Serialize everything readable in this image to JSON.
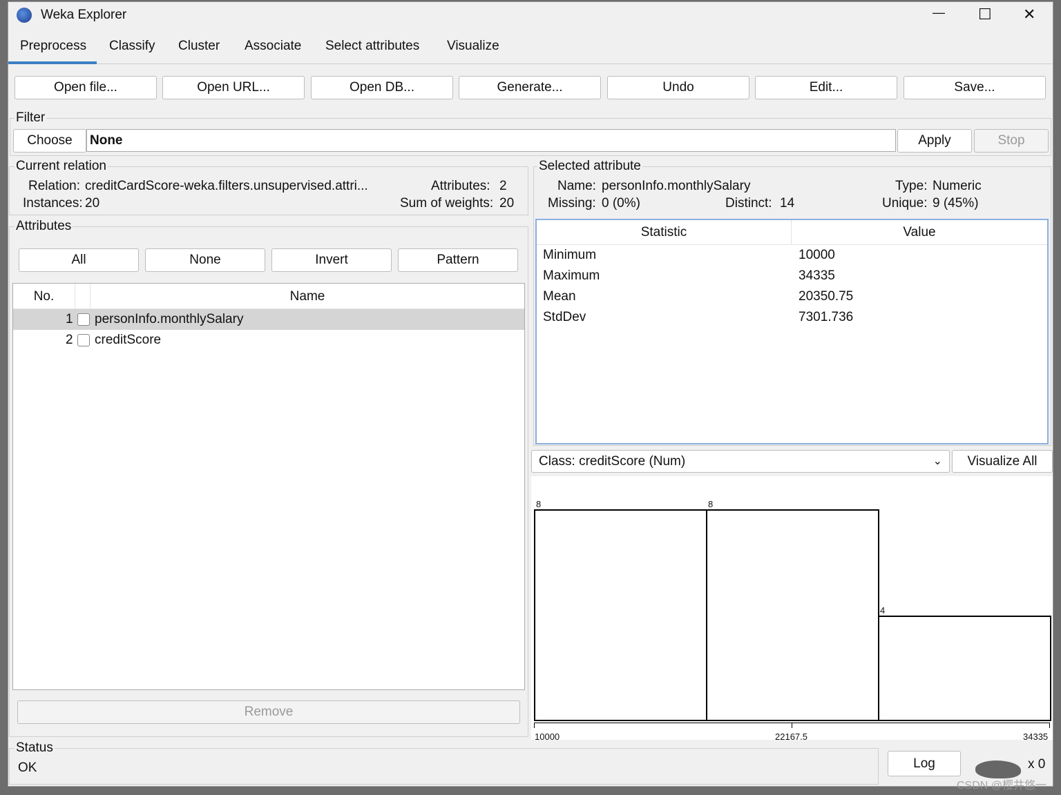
{
  "window": {
    "title": "Weka Explorer",
    "minimize": "—",
    "maximize": "☐",
    "close": "✕"
  },
  "tabs": [
    {
      "label": "Preprocess",
      "active": true
    },
    {
      "label": "Classify"
    },
    {
      "label": "Cluster"
    },
    {
      "label": "Associate"
    },
    {
      "label": "Select attributes"
    },
    {
      "label": "Visualize"
    }
  ],
  "accent": "#3c7fc4",
  "toolbar": [
    "Open file...",
    "Open URL...",
    "Open DB...",
    "Generate...",
    "Undo",
    "Edit...",
    "Save..."
  ],
  "filter": {
    "label": "Filter",
    "choose": "Choose",
    "value": "None",
    "apply": "Apply",
    "stop": "Stop"
  },
  "relation": {
    "label": "Current relation",
    "relation_label": "Relation:",
    "relation": "creditCardScore-weka.filters.unsupervised.attri...",
    "instances_label": "Instances:",
    "instances": "20",
    "attributes_label": "Attributes:",
    "attributes": "2",
    "weights_label": "Sum of weights:",
    "weights": "20"
  },
  "attributes": {
    "label": "Attributes",
    "buttons": [
      "All",
      "None",
      "Invert",
      "Pattern"
    ],
    "col_no": "No.",
    "col_name": "Name",
    "rows": [
      {
        "no": "1",
        "name": "personInfo.monthlySalary",
        "selected": true
      },
      {
        "no": "2",
        "name": "creditScore"
      }
    ],
    "remove": "Remove"
  },
  "selected": {
    "label": "Selected attribute",
    "name_label": "Name:",
    "name": "personInfo.monthlySalary",
    "type_label": "Type:",
    "type": "Numeric",
    "missing_label": "Missing:",
    "missing": "0 (0%)",
    "distinct_label": "Distinct:",
    "distinct": "14",
    "unique_label": "Unique:",
    "unique": "9 (45%)",
    "col_stat": "Statistic",
    "col_value": "Value",
    "stats": [
      {
        "s": "Minimum",
        "v": "10000"
      },
      {
        "s": "Maximum",
        "v": "34335"
      },
      {
        "s": "Mean",
        "v": "20350.75"
      },
      {
        "s": "StdDev",
        "v": "7301.736"
      }
    ]
  },
  "class_select": {
    "value": "Class: creditScore (Num)",
    "visualize_all": "Visualize All"
  },
  "histogram": {
    "counts": [
      8,
      8,
      4
    ],
    "count_labels": [
      "8",
      "8",
      "4"
    ],
    "axis_labels": [
      "10000",
      "22167.5",
      "34335"
    ]
  },
  "status": {
    "label": "Status",
    "text": "OK",
    "log": "Log",
    "x": "x 0"
  },
  "watermark": "CSDN @樱井悠一"
}
